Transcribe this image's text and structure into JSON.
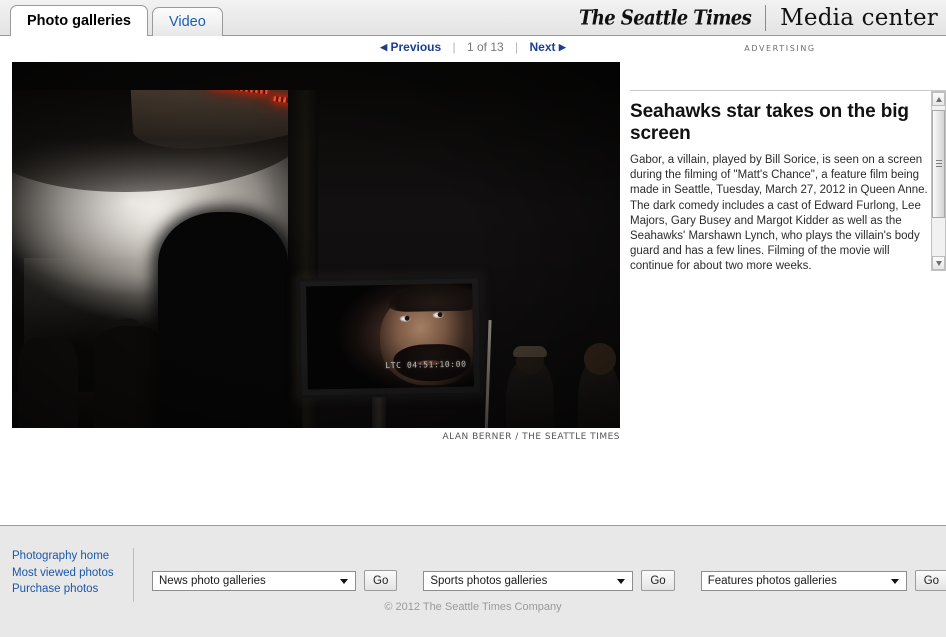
{
  "header": {
    "tabs": [
      {
        "label": "Photo galleries",
        "active": true
      },
      {
        "label": "Video",
        "active": false
      }
    ],
    "brand": "The Seattle Times",
    "section": "Media center"
  },
  "nav": {
    "previous_label": "Previous",
    "previous_arrow": "◀",
    "next_label": "Next",
    "next_arrow": "▶",
    "counter": "1 of 13",
    "separator": "|",
    "ad_label": "ADVERTISING"
  },
  "photo": {
    "credit": "ALAN BERNER / THE SEATTLE TIMES",
    "monitor_timecode": "LTC 04:51:10:00"
  },
  "caption": {
    "title": "Seahawks star takes on the big screen",
    "body": "Gabor, a villain, played by Bill Sorice, is seen on a screen during the filming of \"Matt's Chance\", a feature film being made in Seattle, Tuesday, March 27, 2012 in Queen Anne. The dark comedy includes a cast of Edward Furlong, Lee Majors, Gary Busey and Margot Kidder as well as the Seahawks' Marshawn Lynch, who plays the villain's body guard and has a few lines. Filming of the movie will continue for about two more weeks."
  },
  "footer": {
    "links": [
      "Photography home",
      "Most viewed photos",
      "Purchase photos"
    ],
    "selectors": [
      {
        "value": "News photo galleries",
        "go_label": "Go"
      },
      {
        "value": "Sports photos galleries",
        "go_label": "Go"
      },
      {
        "value": "Features photos galleries",
        "go_label": "Go"
      }
    ],
    "copyright": "© 2012 The Seattle Times Company"
  },
  "colors": {
    "link_blue": "#1b57a8",
    "nav_blue": "#1a3f8f",
    "chrome_gray": "#e8e8e8",
    "led_red": "#ff2a00"
  }
}
